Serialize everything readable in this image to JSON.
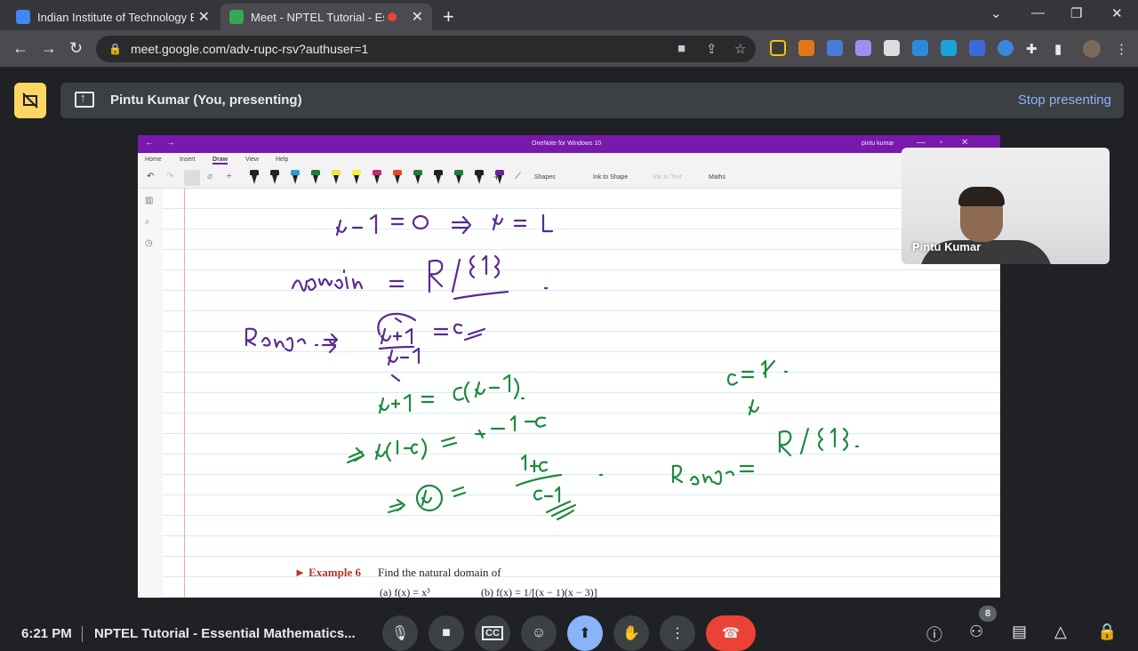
{
  "browser": {
    "tabs": [
      {
        "label": "Indian Institute of Technology Bo",
        "favicon_color": "#4285f4"
      },
      {
        "label": "Meet - NPTEL Tutorial - Esse",
        "favicon_color": "#34a853"
      }
    ],
    "new_tab_glyph": "+",
    "url": "meet.google.com/adv-rupc-rsv?authuser=1"
  },
  "meet": {
    "presenter_label": "Pintu Kumar (You, presenting)",
    "stop_presenting_label": "Stop presenting",
    "self_view_name": "Pintu Kumar",
    "clock": "6:21 PM",
    "meeting_title": "NPTEL Tutorial - Essential Mathematics...",
    "participant_count": "8",
    "accent_colors": {
      "present": "#8ab4f8",
      "leave": "#ea4335",
      "presenting_badge": "#fdd663"
    }
  },
  "onenote": {
    "title": "OneNote for Windows 10",
    "user": "pintu kumar",
    "ribbon_tabs": [
      "Home",
      "Insert",
      "Draw",
      "View",
      "Help"
    ],
    "toolbar": {
      "shapes": "Shapes",
      "ink_to_shape": "Ink to Shape",
      "ink_to_text": "Ink to Text",
      "maths": "Maths"
    },
    "pen_colors": [
      "#222222",
      "#222222",
      "#2aa0c8",
      "#1f7a3a",
      "#e8e83a",
      "#f2f23a",
      "#c8286e",
      "#e04a28",
      "#1f7a3a",
      "#222222",
      "#1f7a3a",
      "#222222",
      "#6a1fa8"
    ],
    "ink_colors": {
      "purple": "#5b2a91",
      "green": "#1e8a3e"
    },
    "handwriting": {
      "purple": [
        "x-1 = 0  ⇒  x = 1",
        "domain = R\\{1}",
        "Range ⇒",
        "x+1",
        "x-1",
        "= c"
      ],
      "green": [
        "x+1 = c(x-1).",
        "⇒ x(1-c) = -1-c",
        "⇒ x =",
        "1+c",
        "c-1",
        "c=1.",
        "x",
        "Range = R\\{1}."
      ]
    },
    "textbook": {
      "example_label": "► Example 6",
      "example_text": "Find the natural domain of",
      "part_a": "(a)  f(x) = x³",
      "part_b": "(b)  f(x) = 1/[(x − 1)(x − 3)]"
    }
  }
}
